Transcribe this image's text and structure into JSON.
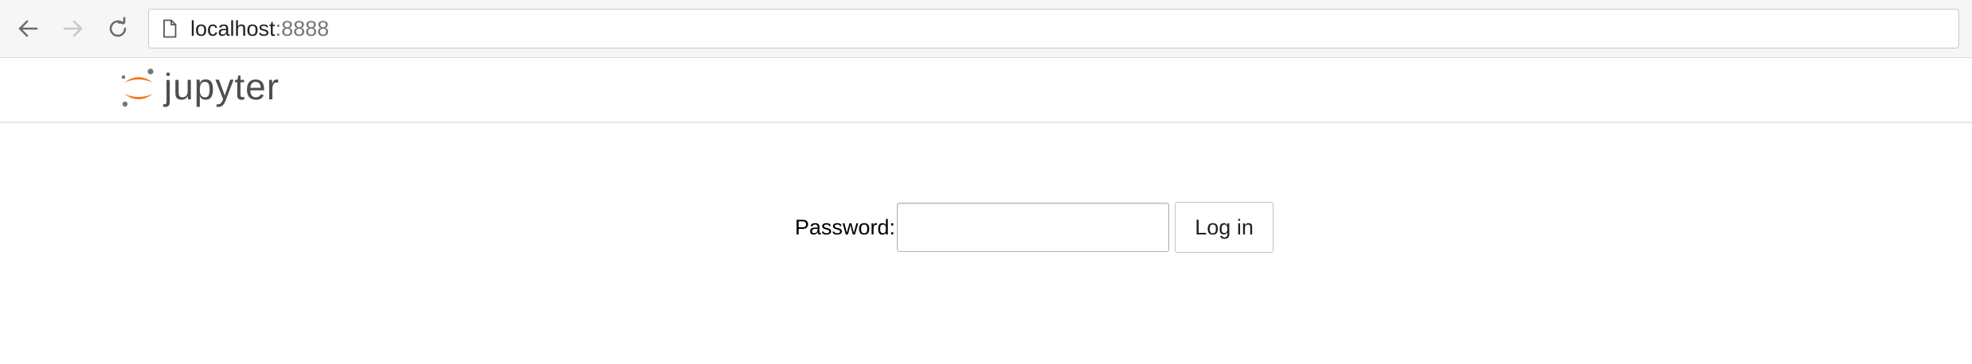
{
  "browser": {
    "url_host": "localhost",
    "url_port": ":8888",
    "icons": {
      "back": "arrow-left-icon",
      "forward": "arrow-right-icon",
      "reload": "reload-icon",
      "page": "page-icon"
    }
  },
  "header": {
    "logo_text": "jupyter",
    "colors": {
      "logo_orange": "#f37726",
      "logo_gray": "#767677",
      "logo_text": "#4e4e4e"
    }
  },
  "login": {
    "password_label": "Password:",
    "password_value": "",
    "submit_label": "Log in"
  }
}
